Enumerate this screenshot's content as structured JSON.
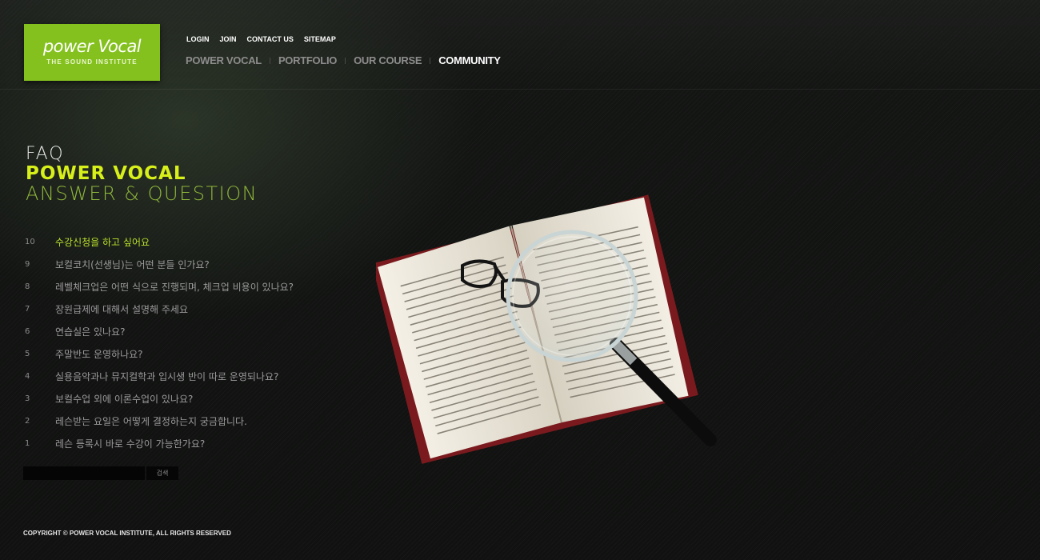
{
  "logo": {
    "main": "power Vocal",
    "sub": "THE SOUND INSTITUTE"
  },
  "util_nav": [
    "LOGIN",
    "JOIN",
    "CONTACT US",
    "SITEMAP"
  ],
  "main_nav": [
    {
      "label": "POWER VOCAL",
      "active": false
    },
    {
      "label": "PORTFOLIO",
      "active": false
    },
    {
      "label": "OUR COURSE",
      "active": false
    },
    {
      "label": "COMMUNITY",
      "active": true
    }
  ],
  "title": {
    "faq": "FAQ",
    "brand": "POWER VOCAL",
    "sub": "ANSWER & QUESTION"
  },
  "faq": [
    {
      "num": "10",
      "question": "수강신청을 하고 싶어요"
    },
    {
      "num": "9",
      "question": "보컬코치(선생님)는 어떤 분들 인가요?"
    },
    {
      "num": "8",
      "question": "레벨체크업은 어떤 식으로 진행되며, 체크업 비용이 있나요?"
    },
    {
      "num": "7",
      "question": "장원급제에 대해서 설명해 주세요"
    },
    {
      "num": "6",
      "question": "연습실은 있나요?"
    },
    {
      "num": "5",
      "question": "주말반도 운영하나요?"
    },
    {
      "num": "4",
      "question": "실용음악과나 뮤지컬학과 입시생 반이 따로 운영되나요?"
    },
    {
      "num": "3",
      "question": "보컬수업 외에 이론수업이 있나요?"
    },
    {
      "num": "2",
      "question": "레슨받는 요일은 어떻게 결정하는지 궁금합니다."
    },
    {
      "num": "1",
      "question": "레슨 등록시 바로 수강이 가능한가요?"
    }
  ],
  "search": {
    "value": "",
    "button_label": "검색"
  },
  "footer": {
    "copyright": "COPYRIGHT © POWER VOCAL INSTITUTE, ALL RIGHTS RESERVED"
  },
  "colors": {
    "brand_green": "#84c11f",
    "accent_yellow": "#d8f01a",
    "active_question": "#b8e02a"
  }
}
